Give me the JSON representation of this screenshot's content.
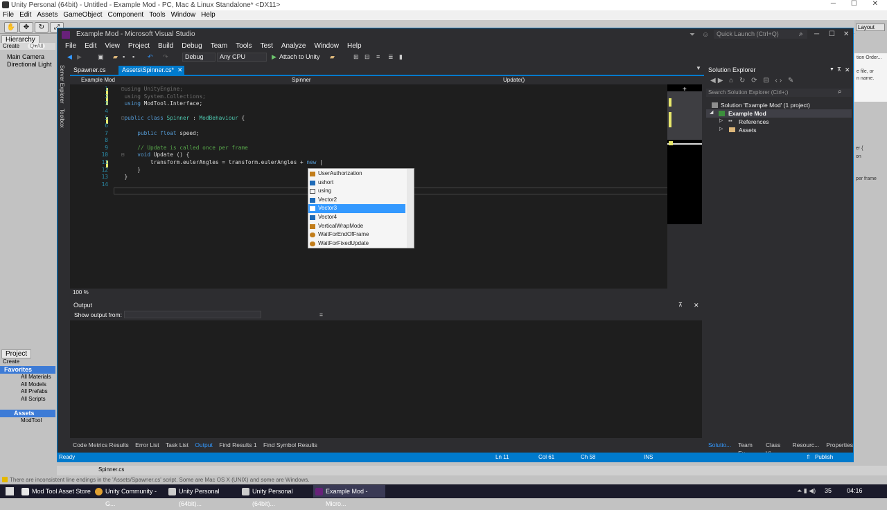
{
  "unity": {
    "window_title": "Unity Personal (64bit) - Untitled - Example Mod - PC, Mac & Linux Standalone* <DX11>",
    "menu": [
      "File",
      "Edit",
      "Assets",
      "GameObject",
      "Component",
      "Tools",
      "Window",
      "Help"
    ],
    "hierarchy": {
      "tab": "Hierarchy",
      "create": "Create",
      "search": "Q▾All",
      "items": [
        "Main Camera",
        "Directional Light"
      ]
    },
    "project": {
      "tab": "Project",
      "create": "Create",
      "favorites": "Favorites",
      "favorite_items": [
        "All Materials",
        "All Models",
        "All Prefabs",
        "All Scripts"
      ],
      "assets": "Assets",
      "asset_items": [
        "ModTool"
      ],
      "bottom_file": "Spinner.cs"
    },
    "right_panel": {
      "button": "Layout",
      "text": [
        "tion Order...",
        "e file, or",
        "n name.",
        "er {",
        "on",
        "per frame"
      ]
    },
    "warning": "There are inconsistent line endings in the 'Assets/Spawner.cs' script. Some are Mac OS X (UNIX) and some are Windows."
  },
  "vs": {
    "title": "Example Mod - Microsoft Visual Studio",
    "quick_launch": "Quick Launch (Ctrl+Q)",
    "menu": [
      "File",
      "Edit",
      "View",
      "Project",
      "Build",
      "Debug",
      "Team",
      "Tools",
      "Test",
      "Analyze",
      "Window",
      "Help"
    ],
    "toolbar": {
      "config": "Debug",
      "platform": "Any CPU",
      "attach": "Attach to Unity"
    },
    "side_tabs": [
      "Server Explorer",
      "Toolbox"
    ],
    "doc_tabs": [
      {
        "label": "Spawner.cs"
      },
      {
        "label": "Assets\\Spinner.cs*"
      }
    ],
    "close_glyph": "✕",
    "nav": {
      "project": "Example Mod",
      "class": "Spinner",
      "member": "Update()"
    },
    "code": {
      "line_numbers": [
        "1",
        "2",
        "3",
        "4",
        "5",
        "6",
        "7",
        "8",
        "9",
        "10",
        "11",
        "12",
        "13",
        "14"
      ],
      "l1a": "using",
      "l1b": " UnityEngine;",
      "l2a": "using",
      "l2b": " System.Collections;",
      "l3a": "using",
      "l3b": " ModTool.Interface;",
      "l5a": "public class ",
      "l5b": "Spinner",
      "l5c": " : ",
      "l5d": "ModBehaviour",
      "l5e": " {",
      "l7a": "public float",
      "l7b": " speed;",
      "l9": "// Update is called once per frame",
      "l10a": "void",
      "l10b": " Update () {",
      "l11a": "transform.eulerAngles = transform.eulerAngles + ",
      "l11b": "new",
      "l12": "}",
      "l14": "}"
    },
    "zoom": "100 %",
    "completion": [
      {
        "label": "UserAuthorization",
        "icon": "enum"
      },
      {
        "label": "ushort",
        "icon": "struct"
      },
      {
        "label": "using",
        "icon": "keyword"
      },
      {
        "label": "Vector2",
        "icon": "struct"
      },
      {
        "label": "Vector3",
        "icon": "struct",
        "selected": true
      },
      {
        "label": "Vector4",
        "icon": "struct"
      },
      {
        "label": "VerticalWrapMode",
        "icon": "enum"
      },
      {
        "label": "WaitForEndOfFrame",
        "icon": "class"
      },
      {
        "label": "WaitForFixedUpdate",
        "icon": "class"
      }
    ],
    "output": {
      "title": "Output",
      "show_from": "Show output from:"
    },
    "bottom_tabs": [
      "Code Metrics Results",
      "Error List",
      "Task List",
      "Output",
      "Find Results 1",
      "Find Symbol Results"
    ],
    "active_bottom_tab": "Output",
    "solution_explorer": {
      "title": "Solution Explorer",
      "search": "Search Solution Explorer (Ctrl+;)",
      "solution": "Solution 'Example Mod' (1 project)",
      "project": "Example Mod",
      "items": [
        "References",
        "Assets"
      ]
    },
    "right_tabs": [
      "Solutio...",
      "Team Ex...",
      "Class Vi...",
      "Resourc...",
      "Properties"
    ],
    "status": {
      "ready": "Ready",
      "ln": "Ln 11",
      "col": "Col 61",
      "ch": "Ch 58",
      "mode": "INS",
      "publish": "Publish"
    }
  },
  "taskbar": {
    "items": [
      "Mod Tool Asset Store",
      "Unity Community - G...",
      "Unity Personal (64bit)...",
      "Unity Personal (64bit)...",
      "Example Mod - Micro..."
    ],
    "tray": {
      "time": "04:16",
      "label": "35"
    }
  },
  "colors": {
    "vs_accent": "#007acc",
    "selection": "#3399ff",
    "keyword": "#569cd6",
    "type": "#4ec9b0",
    "comment": "#57a64a"
  }
}
